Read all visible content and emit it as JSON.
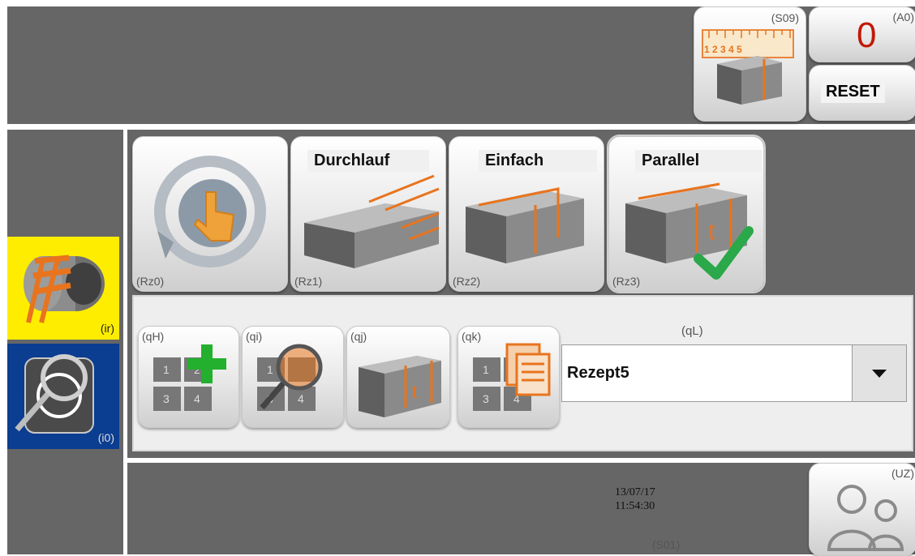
{
  "header": {
    "scale_button_code": "(S09)",
    "scale_numbers": "1 2 3 4 5",
    "counter_code": "(A0)",
    "counter_value": "0",
    "reset_label": "RESET"
  },
  "left_modes": {
    "yellow_code": "(ir)",
    "blue_code": "(i0)"
  },
  "modes": [
    {
      "code": "(Rz0)",
      "title": ""
    },
    {
      "code": "(Rz1)",
      "title": "Durchlauf"
    },
    {
      "code": "(Rz2)",
      "title": "Einfach"
    },
    {
      "code": "(Rz3)",
      "title": "Parallel",
      "selected": true
    }
  ],
  "recipe_tools": [
    {
      "code": "(qH)"
    },
    {
      "code": "(qi)"
    },
    {
      "code": "(qj)"
    },
    {
      "code": "(qk)"
    }
  ],
  "recipe_select": {
    "code": "(qL)",
    "value": "Rezept5"
  },
  "footer": {
    "date": "13/07/17",
    "time": "11:54:30",
    "status_code": "(S01)",
    "user_code": "(UZ)"
  },
  "colors": {
    "panel_gray": "#666666",
    "accent_orange": "#e8741e",
    "check_green": "#2aa84a",
    "plus_green": "#22b02e",
    "counter_red": "#c21807",
    "mode_yellow": "#ffed00",
    "mode_blue": "#0b3d91"
  }
}
